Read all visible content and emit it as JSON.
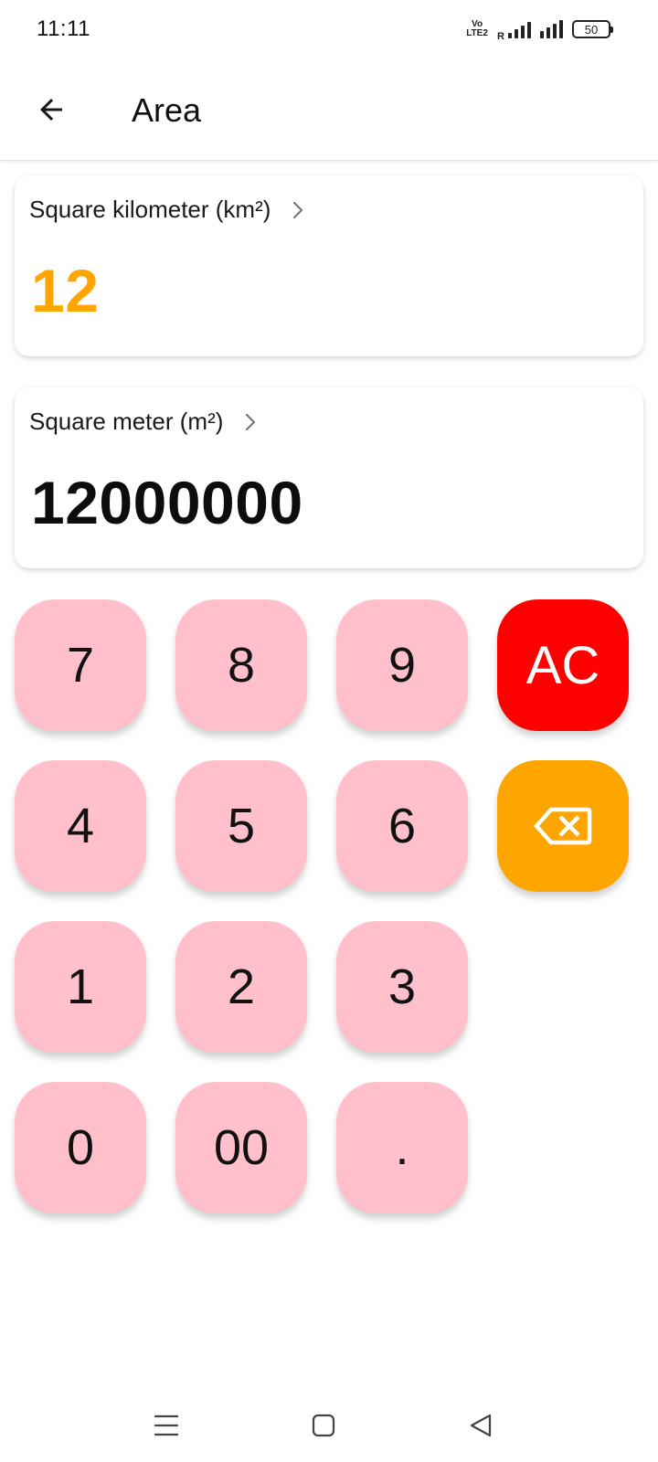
{
  "status_bar": {
    "time": "11:11",
    "volte_top": "Vo",
    "volte_bottom": "LTE2",
    "roaming": "R",
    "battery": "50"
  },
  "app_bar": {
    "title": "Area",
    "back_icon": "arrow-back-icon"
  },
  "source_unit": {
    "label": "Square kilometer (km²)",
    "value": "12",
    "value_color": "#ffa500"
  },
  "target_unit": {
    "label": "Square meter (m²)",
    "value": "12000000",
    "value_color": "#0d0d0d"
  },
  "keypad": {
    "key_7": "7",
    "key_8": "8",
    "key_9": "9",
    "clear": "AC",
    "key_4": "4",
    "key_5": "5",
    "key_6": "6",
    "backspace_icon": "backspace-icon",
    "key_1": "1",
    "key_2": "2",
    "key_3": "3",
    "key_0": "0",
    "key_00": "00",
    "key_dot": ".",
    "colors": {
      "digit_key": "#ffc0cb",
      "clear_key": "#ff0000",
      "backspace_key": "#ffa500"
    }
  },
  "nav_bar": {
    "icons": [
      "menu-icon",
      "home-icon",
      "back-triangle-icon"
    ]
  }
}
